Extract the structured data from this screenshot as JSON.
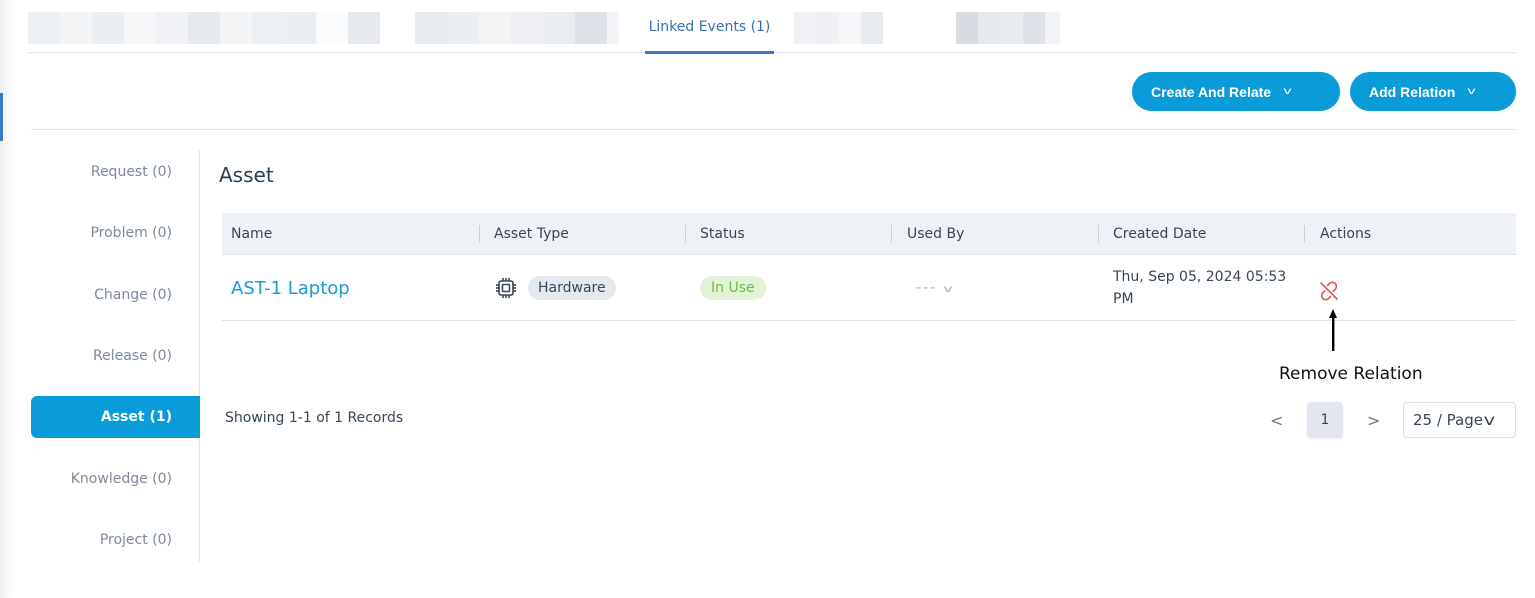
{
  "tabs": {
    "active_label": "Linked Events (1)"
  },
  "toolbar": {
    "create_and_relate_label": "Create And Relate",
    "add_relation_label": "Add Relation",
    "chevron_glyph": "v"
  },
  "sidenav": {
    "items": [
      {
        "label": "Request (0)"
      },
      {
        "label": "Problem (0)"
      },
      {
        "label": "Change (0)"
      },
      {
        "label": "Release (0)"
      },
      {
        "label": "Asset (1)",
        "active": true
      },
      {
        "label": "Knowledge (0)"
      },
      {
        "label": "Project (0)"
      }
    ]
  },
  "main": {
    "section_title": "Asset",
    "table": {
      "columns": [
        "Name",
        "Asset Type",
        "Status",
        "Used By",
        "Created Date",
        "Actions"
      ],
      "rows": [
        {
          "name": "AST-1 Laptop",
          "asset_type": "Hardware",
          "asset_type_icon": "chip-icon",
          "status": "In Use",
          "used_by": "---",
          "created_date": "Thu, Sep 05, 2024 05:53 PM",
          "action_icon": "unlink-icon"
        }
      ]
    },
    "annotation": "Remove Relation"
  },
  "pagination": {
    "summary": "Showing 1-1 of 1 Records",
    "prev": "<",
    "current_page": "1",
    "next": ">",
    "page_size": "25 / Page"
  },
  "colors": {
    "accent": "#0a9bd9",
    "tab_active": "#3a78c0",
    "status_in_use": "#6dbd3c",
    "remove_relation": "#e8534a"
  }
}
